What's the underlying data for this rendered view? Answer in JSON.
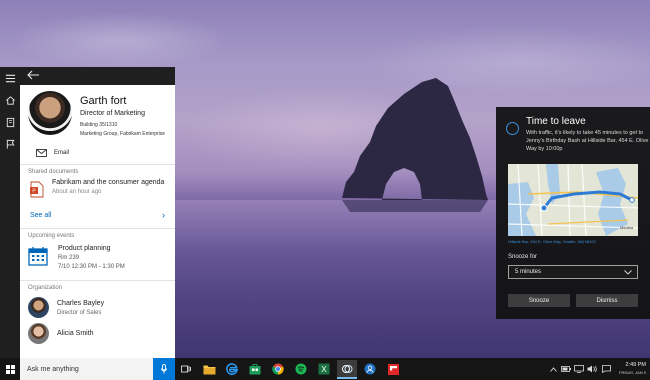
{
  "cortana": {
    "contact": {
      "name": "Garth fort",
      "title": "Director of Marketing",
      "building": "Building 35/1310",
      "group": "Marketing Group, Fabrikam Enterprise",
      "email_label": "Email"
    },
    "shared_documents": {
      "label": "Shared documents",
      "items": [
        {
          "title": "Fabrikam and the consumer agenda",
          "subtitle": "About an hour ago"
        }
      ],
      "see_all": "See all"
    },
    "upcoming_events": {
      "label": "Upcoming events",
      "items": [
        {
          "title": "Product planning",
          "room": "Rm 239",
          "when": "7/10 12:30 PM - 1:30 PM"
        }
      ]
    },
    "organization": {
      "label": "Organization",
      "people": [
        {
          "name": "Charles Bayley",
          "title": "Director of Sales"
        },
        {
          "name": "Alicia Smith",
          "title": ""
        }
      ]
    }
  },
  "time_to_leave": {
    "title": "Time to leave",
    "body": "With traffic, it's likely to take 45 minutes to get to Jenny's Birthday Bash at Hillside Bar, 454 E. Olive Way by 10:00p",
    "address": "Hillside Bar, 454 E. Olive Way, Seattle, WA 98102",
    "snooze_label": "Snooze for",
    "snooze_value": "5 minutes",
    "snooze_button": "Snooze",
    "dismiss_button": "Dismiss",
    "map_labels": [
      "Medina"
    ]
  },
  "taskbar": {
    "search_placeholder": "Ask me anything",
    "clock_time": "2:49 PM",
    "clock_date": "FRIDAY, JAN 9"
  },
  "colors": {
    "accent": "#0078d7",
    "link": "#0067b8",
    "taskbar": "#151515",
    "notification_bg": "#121212"
  },
  "icons": {
    "strip": [
      "hamburger-icon",
      "home-icon",
      "notebook-icon",
      "feedback-icon"
    ],
    "taskbar": [
      "task-view-icon",
      "file-explorer-icon",
      "edge-icon",
      "store-icon",
      "chrome-icon",
      "spotify-icon",
      "excel-icon",
      "cortana-icon",
      "people-icon",
      "flipboard-icon"
    ]
  }
}
